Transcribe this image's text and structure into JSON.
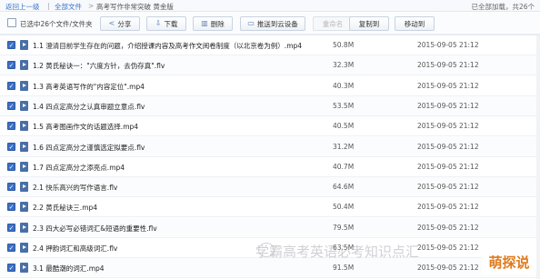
{
  "breadcrumb": {
    "back": "返回上一级",
    "sep1": "|",
    "all": "全部文件",
    "sep2": ">",
    "path1": "高考写作非常突破 黄金版",
    "status": "已全部加载，共26个"
  },
  "toolbar": {
    "select_label": "已选中26个文件/文件夹",
    "share": "分享",
    "download": "下载",
    "delete": "删除",
    "push": "推送到云设备",
    "rename": "重命名",
    "copy": "复制到",
    "move": "移动到"
  },
  "files": [
    {
      "name": "1.1 澄清目前学生存在的问题，介绍授课内容及高考作文阅卷制度（以北京卷为例）.mp4",
      "size": "50.8M",
      "date": "2015-09-05 21:12"
    },
    {
      "name": "1.2 黄氏秘诀一：\"六度方针，去伪存真\".flv",
      "size": "32.3M",
      "date": "2015-09-05 21:12"
    },
    {
      "name": "1.3 高考英语写作的\"内容定位\".mp4",
      "size": "40.3M",
      "date": "2015-09-05 21:12"
    },
    {
      "name": "1.4 四点定高分之认真审题立意点.flv",
      "size": "53.5M",
      "date": "2015-09-05 21:12"
    },
    {
      "name": "1.5 高考图画作文的话题选择.mp4",
      "size": "40.5M",
      "date": "2015-09-05 21:12"
    },
    {
      "name": "1.6 四点定高分之谨慎选定拟要点.flv",
      "size": "31.2M",
      "date": "2015-09-05 21:12"
    },
    {
      "name": "1.7 四点定高分之添亮点.mp4",
      "size": "40.7M",
      "date": "2015-09-05 21:12"
    },
    {
      "name": "2.1 快乐高兴的写作语言.flv",
      "size": "64.6M",
      "date": "2015-09-05 21:12"
    },
    {
      "name": "2.2 黄氏秘诀三.mp4",
      "size": "50.4M",
      "date": "2015-09-05 21:12"
    },
    {
      "name": "2.3 四大必写必错词汇&短语的重要性.flv",
      "size": "79.5M",
      "date": "2015-09-05 21:12"
    },
    {
      "name": "2.4 押韵词汇和高级词汇.flv",
      "size": "63.5M",
      "date": "2015-09-05 21:12"
    },
    {
      "name": "3.1 最酷潮的词汇.mp4",
      "size": "91.5M",
      "date": "2015-09-05 21:12"
    }
  ],
  "watermark": {
    "text": "学霸高考英语必考知识点汇"
  },
  "logo": {
    "text": "萌探说"
  },
  "colors": {
    "accent": "#3a6fc4",
    "link": "#3a74c8"
  }
}
